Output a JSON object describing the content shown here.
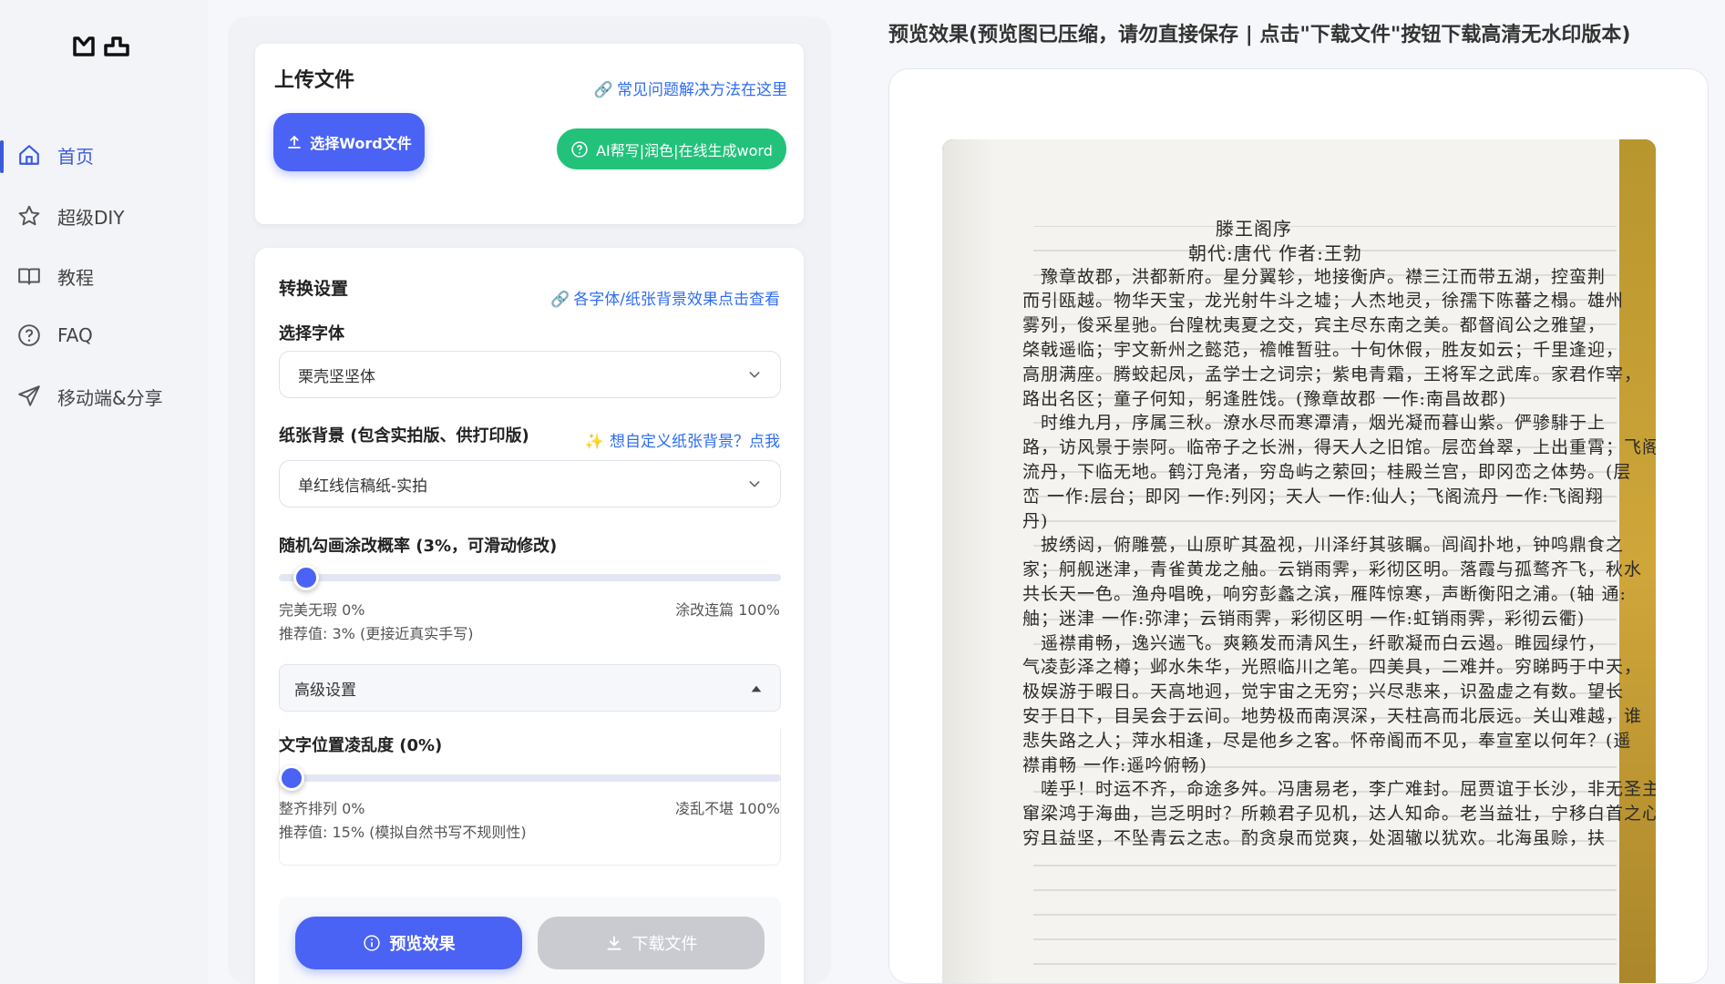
{
  "sidebar": {
    "items": [
      {
        "label": "首页",
        "icon": "home-icon",
        "active": true
      },
      {
        "label": "超级DIY",
        "icon": "star-icon",
        "active": false
      },
      {
        "label": "教程",
        "icon": "book-icon",
        "active": false
      },
      {
        "label": "FAQ",
        "icon": "question-icon",
        "active": false
      },
      {
        "label": "移动端&分享",
        "icon": "send-icon",
        "active": false
      }
    ]
  },
  "upload": {
    "title": "上传文件",
    "faq_link": "常见问题解决方法在这里",
    "choose_button": "选择Word文件",
    "ai_button": "AI帮写|润色|在线生成word"
  },
  "settings": {
    "title": "转换设置",
    "effects_link": "各字体/纸张背景效果点击查看",
    "font_label": "选择字体",
    "font_value": "栗壳坚坚体",
    "paper_label": "纸张背景 (包含实拍版、供打印版)",
    "paper_custom_link": "想自定义纸张背景？点我",
    "paper_value": "单红线信稿纸-实拍",
    "scribble_label": "随机勾画涂改概率 (3%，可滑动修改)",
    "scribble_value": 0.03,
    "scribble_min": "完美无瑕 0%",
    "scribble_max": "涂改连篇 100%",
    "scribble_hint": "推荐值: 3% (更接近真实手写)",
    "advanced_label": "高级设置",
    "disorder_label": "文字位置凌乱度 (0%)",
    "disorder_value": 0.0,
    "disorder_min": "整齐排列 0%",
    "disorder_max": "凌乱不堪 100%",
    "disorder_hint": "推荐值: 15% (模拟自然书写不规则性)",
    "preview_button": "预览效果",
    "download_button": "下载文件"
  },
  "preview": {
    "title": "预览效果(预览图已压缩，请勿直接保存 | 点击\"下载文件\"按钮下载高清无水印版本)",
    "handwriting": [
      "滕王阁序",
      "朝代:唐代 作者:王勃",
      "豫章故郡，洪都新府。星分翼轸，地接衡庐。襟三江而带五湖，控蛮荆",
      "而引瓯越。物华天宝，龙光射牛斗之墟；人杰地灵，徐孺下陈蕃之榻。雄州",
      "雾列，俊采星驰。台隍枕夷夏之交，宾主尽东南之美。都督阎公之雅望，",
      "棨戟遥临；宇文新州之懿范，襜帷暂驻。十旬休假，胜友如云；千里逢迎，",
      "高朋满座。腾蛟起凤，孟学士之词宗；紫电青霜，王将军之武库。家君作宰，",
      "路出名区；童子何知，躬逢胜饯。(豫章故郡 一作:南昌故郡)",
      "时维九月，序属三秋。潦水尽而寒潭清，烟光凝而暮山紫。俨骖騑于上",
      "路，访风景于崇阿。临帝子之长洲，得天人之旧馆。层峦耸翠，上出重霄；飞阁",
      "流丹，下临无地。鹤汀凫渚，穷岛屿之萦回；桂殿兰宫，即冈峦之体势。(层",
      "峦 一作:层台；即冈 一作:列冈；天人 一作:仙人；飞阁流丹 一作:飞阁翔",
      "丹)",
      "披绣闼，俯雕甍，山原旷其盈视，川泽纡其骇瞩。闾阎扑地，钟鸣鼎食之",
      "家；舸舰迷津，青雀黄龙之舳。云销雨霁，彩彻区明。落霞与孤鹜齐飞，秋水",
      "共长天一色。渔舟唱晚，响穷彭蠡之滨，雁阵惊寒，声断衡阳之浦。(轴 通:",
      "舳；迷津 一作:弥津；云销雨霁，彩彻区明 一作:虹销雨霁，彩彻云衢)",
      "遥襟甫畅，逸兴遄飞。爽籁发而清风生，纤歌凝而白云遏。睢园绿竹，",
      "气凌彭泽之樽；邺水朱华，光照临川之笔。四美具，二难并。穷睇眄于中天，",
      "极娱游于暇日。天高地迥，觉宇宙之无穷；兴尽悲来，识盈虚之有数。望长",
      "安于日下，目吴会于云间。地势极而南溟深，天柱高而北辰远。关山难越，谁",
      "悲失路之人；萍水相逢，尽是他乡之客。怀帝阍而不见，奉宣室以何年？(遥",
      "襟甫畅 一作:遥吟俯畅)",
      "嗟乎！时运不齐，命途多舛。冯唐易老，李广难封。屈贾谊于长沙，非无圣主；",
      "窜梁鸿于海曲，岂乏明时？所赖君子见机，达人知命。老当益壮，宁移白首之心？",
      "穷且益坚，不坠青云之志。酌贪泉而觉爽，处涸辙以犹欢。北海虽赊，扶"
    ]
  },
  "colors": {
    "accent": "#4a63f5",
    "green": "#22c27b",
    "link": "#2f6cf5"
  }
}
